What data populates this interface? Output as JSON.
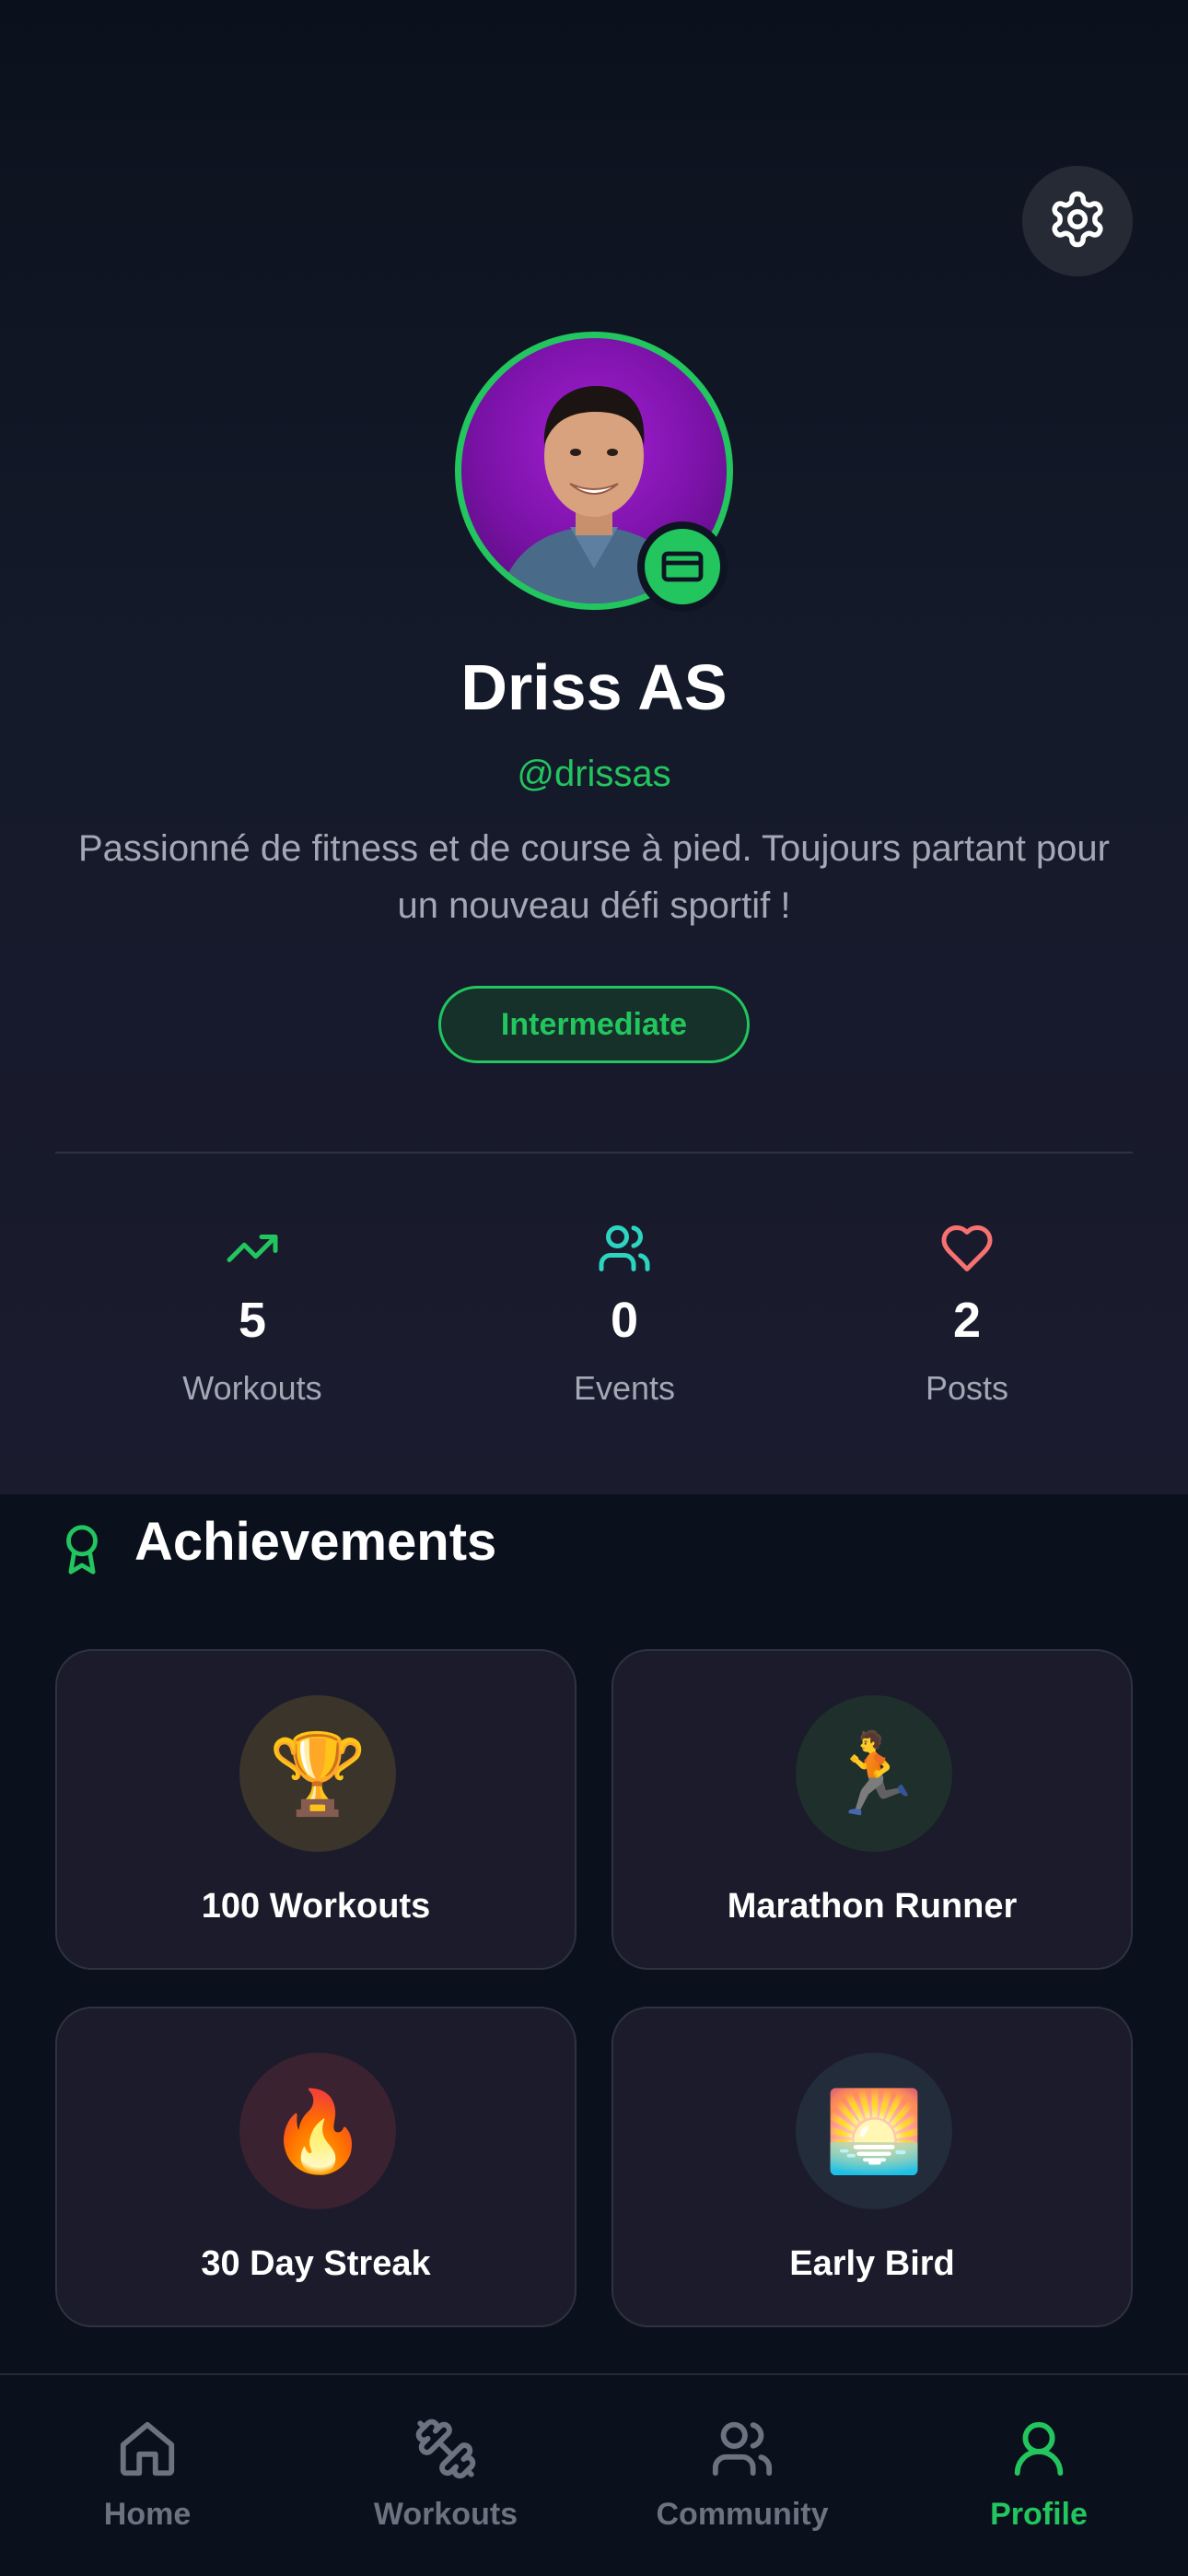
{
  "profile": {
    "name": "Driss AS",
    "handle": "@drissas",
    "bio": "Passionné de fitness et de course à pied. Toujours partant pour un nouveau défi sportif !",
    "level": "Intermediate"
  },
  "stats": [
    {
      "icon": "trending-up-icon",
      "value": "5",
      "label": "Workouts",
      "color": "#22c55e"
    },
    {
      "icon": "users-icon",
      "value": "0",
      "label": "Events",
      "color": "#2dd4bf"
    },
    {
      "icon": "heart-icon",
      "value": "2",
      "label": "Posts",
      "color": "#f87171"
    }
  ],
  "achievements": {
    "title": "Achievements",
    "items": [
      {
        "emoji": "🏆",
        "label": "100 Workouts",
        "bg": "#3a342a"
      },
      {
        "emoji": "🏃",
        "label": "Marathon Runner",
        "bg": "#1f2f2c"
      },
      {
        "emoji": "🔥",
        "label": "30 Day Streak",
        "bg": "#3a2230"
      },
      {
        "emoji": "🌅",
        "label": "Early Bird",
        "bg": "#222c3b"
      }
    ]
  },
  "nav": {
    "items": [
      {
        "label": "Home",
        "icon": "home-icon"
      },
      {
        "label": "Workouts",
        "icon": "dumbbell-icon"
      },
      {
        "label": "Community",
        "icon": "users-icon"
      },
      {
        "label": "Profile",
        "icon": "user-icon"
      }
    ],
    "active": "Profile"
  },
  "colors": {
    "accent": "#22c55e",
    "background": "#0b111c",
    "card": "#1b1b2b"
  }
}
